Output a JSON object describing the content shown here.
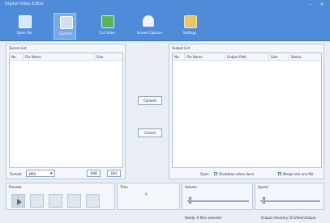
{
  "window": {
    "title": "Digital Video Editor"
  },
  "toolbar": {
    "items": [
      {
        "label": "Open File",
        "icon": "open-file-icon"
      },
      {
        "label": "Convert",
        "icon": "convert-icon"
      },
      {
        "label": "Cut Video",
        "icon": "cut-video-icon"
      },
      {
        "label": "Screen Capture",
        "icon": "screen-capture-icon"
      },
      {
        "label": "Settings",
        "icon": "settings-icon"
      }
    ]
  },
  "left_panel": {
    "header": "Source List",
    "columns": [
      "No.",
      "File Name",
      "Size"
    ],
    "format_label": "Format:",
    "format_value": "MP4",
    "add_label": "Add",
    "remove_label": "Del"
  },
  "middle": {
    "button_top": "Convert",
    "button_bottom": "Cancel"
  },
  "right_panel": {
    "header": "Output List",
    "columns": [
      "No.",
      "File Name",
      "Output Path",
      "Size",
      "Status"
    ],
    "option1_label": "Open",
    "option2_label": "Shutdown when done",
    "option3_label": "Merge into one file"
  },
  "bottom": {
    "playback_header": "Preview",
    "time_header": "Time",
    "time_value": "0",
    "volume_header": "Volume",
    "speed_header": "Speed",
    "status_left": "Ready: 0 files selected",
    "status_right": "Output directory: D:\\Video\\Output"
  },
  "colors": {
    "toolbar_bg": "#4f8bd8",
    "window_bg": "#e9eef5"
  }
}
